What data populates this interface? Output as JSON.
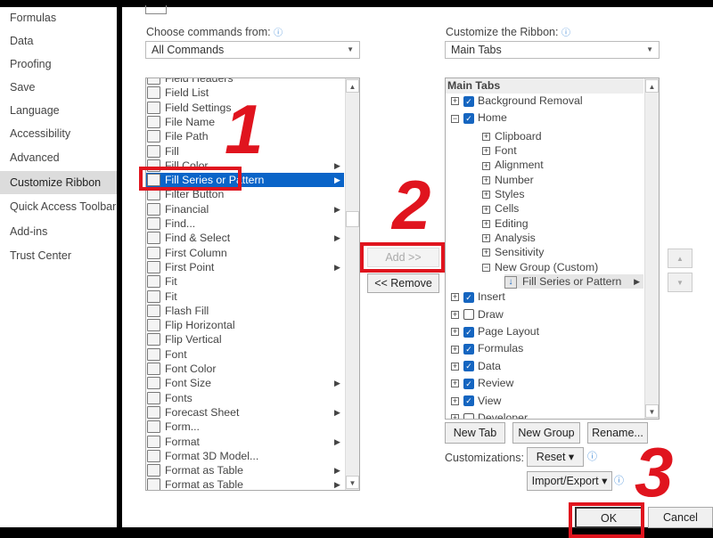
{
  "sidebar": {
    "items": [
      "Formulas",
      "Data",
      "Proofing",
      "Save",
      "Language",
      "Accessibility",
      "Advanced",
      "Customize Ribbon",
      "Quick Access Toolbar",
      "Add-ins",
      "Trust Center"
    ],
    "selected": "Customize Ribbon"
  },
  "left": {
    "label": "Choose commands from:",
    "value": "All Commands",
    "commands": [
      "Field Headers",
      "Field List",
      "Field Settings",
      "File Name",
      "File Path",
      "Fill",
      "Fill Color",
      "Fill Series or Pattern",
      "Filter Button",
      "Financial",
      "Find...",
      "Find & Select",
      "First Column",
      "First Point",
      "Fit",
      "Fit",
      "Flash Fill",
      "Flip Horizontal",
      "Flip Vertical",
      "Font",
      "Font Color",
      "Font Size",
      "Fonts",
      "Forecast Sheet",
      "Form...",
      "Format",
      "Format 3D Model...",
      "Format as Table",
      "Format as Table"
    ],
    "submenu": [
      6,
      7,
      9,
      11,
      13,
      21,
      23,
      25,
      27,
      28
    ],
    "selected_index": 7
  },
  "right": {
    "label": "Customize the Ribbon:",
    "value": "Main Tabs",
    "header": "Main Tabs",
    "tree": [
      {
        "t": "Background Removal",
        "lvl": 0,
        "pm": "+",
        "cb": true
      },
      {
        "t": "Home",
        "lvl": 0,
        "pm": "-",
        "cb": true
      },
      {
        "t": "Clipboard",
        "lvl": 1,
        "pm": "+"
      },
      {
        "t": "Font",
        "lvl": 1,
        "pm": "+"
      },
      {
        "t": "Alignment",
        "lvl": 1,
        "pm": "+"
      },
      {
        "t": "Number",
        "lvl": 1,
        "pm": "+"
      },
      {
        "t": "Styles",
        "lvl": 1,
        "pm": "+"
      },
      {
        "t": "Cells",
        "lvl": 1,
        "pm": "+"
      },
      {
        "t": "Editing",
        "lvl": 1,
        "pm": "+"
      },
      {
        "t": "Analysis",
        "lvl": 1,
        "pm": "+"
      },
      {
        "t": "Sensitivity",
        "lvl": 1,
        "pm": "+"
      },
      {
        "t": "New Group (Custom)",
        "lvl": 1,
        "pm": "-"
      },
      {
        "t": "Fill Series or Pattern",
        "lvl": 2
      },
      {
        "t": "Insert",
        "lvl": 0,
        "pm": "+",
        "cb": true
      },
      {
        "t": "Draw",
        "lvl": 0,
        "pm": "+",
        "cb": false
      },
      {
        "t": "Page Layout",
        "lvl": 0,
        "pm": "+",
        "cb": true
      },
      {
        "t": "Formulas",
        "lvl": 0,
        "pm": "+",
        "cb": true
      },
      {
        "t": "Data",
        "lvl": 0,
        "pm": "+",
        "cb": true
      },
      {
        "t": "Review",
        "lvl": 0,
        "pm": "+",
        "cb": true
      },
      {
        "t": "View",
        "lvl": 0,
        "pm": "+",
        "cb": true
      },
      {
        "t": "Developer",
        "lvl": 0,
        "pm": "+",
        "cb": false
      }
    ]
  },
  "buttons": {
    "add": "Add >>",
    "remove": "<< Remove",
    "new_tab": "New Tab",
    "new_group": "New Group",
    "rename": "Rename...",
    "customizations": "Customizations:",
    "reset": "Reset",
    "import_export": "Import/Export",
    "ok": "OK",
    "cancel": "Cancel"
  },
  "annotations": [
    "1",
    "2",
    "3"
  ],
  "colors": {
    "accent": "#0a64c8",
    "annotation": "#e0141e"
  }
}
